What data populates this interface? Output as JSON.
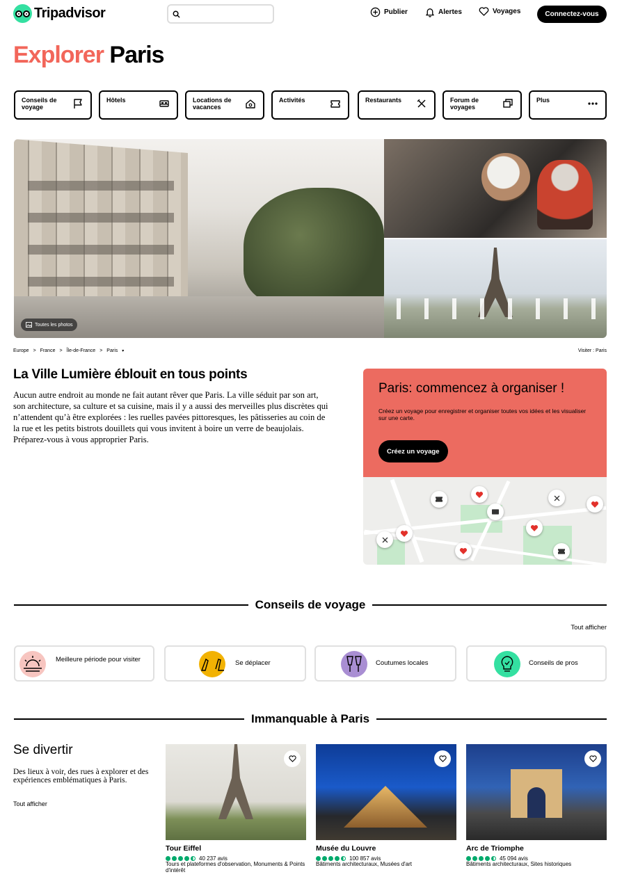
{
  "header": {
    "logo_text": "Tripadvisor",
    "search_placeholder": "",
    "publish_label": "Publier",
    "alerts_label": "Alertes",
    "trips_label": "Voyages",
    "login_label": "Connectez-vous"
  },
  "title": {
    "accent": "Explorer",
    "place": "Paris"
  },
  "categories": [
    {
      "label": "Conseils de voyage",
      "icon": "flag-icon"
    },
    {
      "label": "Hôtels",
      "icon": "bed-icon"
    },
    {
      "label": "Locations de vacances",
      "icon": "house-icon"
    },
    {
      "label": "Activités",
      "icon": "ticket-icon"
    },
    {
      "label": "Restaurants",
      "icon": "fork-knife-icon"
    },
    {
      "label": "Forum de voyages",
      "icon": "chat-icon"
    },
    {
      "label": "Plus",
      "icon": "more-dots-icon"
    }
  ],
  "gallery": {
    "all_photos_label": "Toutes les photos"
  },
  "breadcrumb": [
    "Europe",
    "France",
    "Île-de-France",
    "Paris"
  ],
  "visit_label": "Visiter : Paris",
  "about": {
    "title": "La Ville Lumière éblouit en tous points",
    "text": "Aucun autre endroit au monde ne fait autant rêver que Paris. La ville séduit par son art, son architecture, sa culture et sa cuisine, mais il y a aussi des merveilles plus discrètes qui n’attendent qu’à être explorées : les ruelles pavées pittoresques, les pâtisseries au coin de la rue et les petits bistrots douillets qui vous invitent à boire un verre de beaujolais. Préparez-vous à vous approprier Paris."
  },
  "plan": {
    "title": "Paris: commencez à organiser !",
    "description": "Créez un voyage pour enregistrer et organiser toutes vos idées et les visualiser sur une carte.",
    "button": "Créez un voyage"
  },
  "tips": {
    "heading": "Conseils de voyage",
    "see_all": "Tout afficher",
    "items": [
      {
        "label": "Meilleure période pour visiter",
        "color": "#f7c5c0"
      },
      {
        "label": "Se déplacer",
        "color": "#f2b203"
      },
      {
        "label": "Coutumes locales",
        "color": "#a98ed3"
      },
      {
        "label": "Conseils de pros",
        "color": "#34e0a1"
      }
    ]
  },
  "unmissable": {
    "heading": "Immanquable à Paris",
    "section_title": "Se divertir",
    "section_desc": "Des lieux à voir, des rues à explorer et des expériences emblématiques à Paris.",
    "section_link": "Tout afficher",
    "cards": [
      {
        "name": "Tour Eiffel",
        "rating": 4.5,
        "reviews": "40 237 avis",
        "category": "Tours et plateformes d'observation, Monuments & Points d'intérêt"
      },
      {
        "name": "Musée du Louvre",
        "rating": 4.5,
        "reviews": "100 857 avis",
        "category": "Bâtiments architecturaux, Musées d'art"
      },
      {
        "name": "Arc de Triomphe",
        "rating": 4.5,
        "reviews": "45 094 avis",
        "category": "Bâtiments architecturaux, Sites historiques"
      }
    ]
  },
  "colors": {
    "accent": "#f2665a",
    "green": "#00aa6c",
    "plan_bg": "#ec6b60"
  }
}
